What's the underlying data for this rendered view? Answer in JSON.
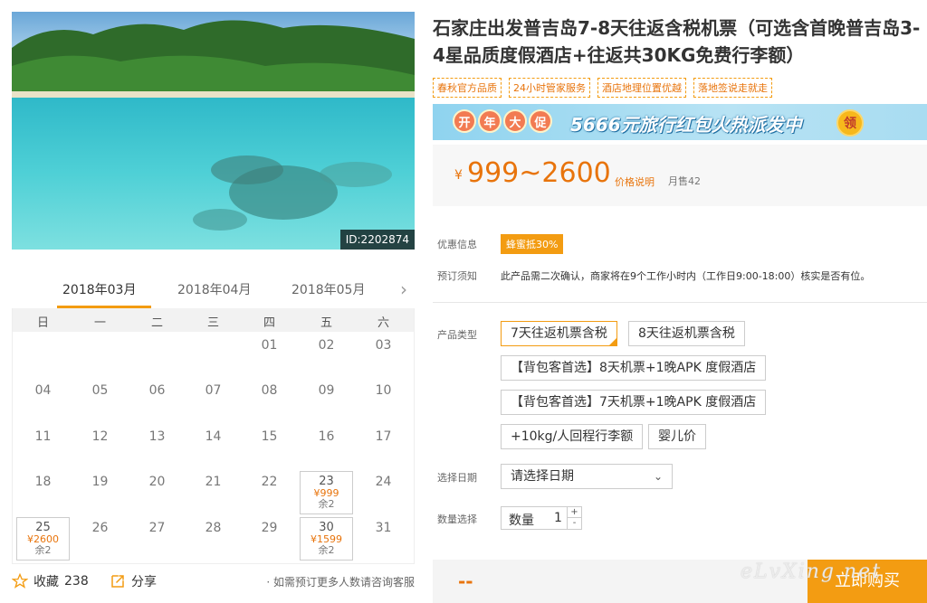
{
  "product": {
    "image_id": "ID:2202874",
    "title": "石家庄出发普吉岛7-8天往返含税机票（可选含首晚普吉岛3-4星品质度假酒店+往返共30KG免费行李额）",
    "tags": [
      "春秋官方品质",
      "24小时管家服务",
      "酒店地理位置优越",
      "落地签说走就走"
    ]
  },
  "promo": {
    "badges": [
      "开",
      "年",
      "大",
      "促"
    ],
    "text": "5666元旅行红包火热派发中",
    "coin": "领"
  },
  "price": {
    "symbol": "¥",
    "range": "999~2600",
    "note": "价格说明",
    "sold": "月售42"
  },
  "labels": {
    "offer": "优惠信息",
    "notice": "预订须知",
    "type": "产品类型",
    "date": "选择日期",
    "qty": "数量选择"
  },
  "offer_badge": "蜂蜜抵30%",
  "notice_text": "此产品需二次确认，商家将在9个工作小时内（工作日9:00-18:00）核实是否有位。",
  "options": [
    {
      "label": "7天往返机票含税",
      "selected": true
    },
    {
      "label": "8天往返机票含税",
      "selected": false
    },
    {
      "label": "【背包客首选】8天机票+1晚APK 度假酒店",
      "selected": false
    },
    {
      "label": "【背包客首选】7天机票+1晚APK 度假酒店",
      "selected": false
    },
    {
      "label": "+10kg/人回程行李额",
      "selected": false
    },
    {
      "label": "婴儿价",
      "selected": false
    }
  ],
  "date_select": {
    "placeholder": "请选择日期"
  },
  "quantity": {
    "label": "数量",
    "value": "1",
    "up": "+",
    "down": "-"
  },
  "buy": {
    "price": "--",
    "button": "立即购买"
  },
  "watermark": "eLvXing.net",
  "calendar": {
    "months": [
      "2018年03月",
      "2018年04月",
      "2018年05月"
    ],
    "active_month": 0,
    "next_arrow": "›",
    "weekdays": [
      "日",
      "一",
      "二",
      "三",
      "四",
      "五",
      "六"
    ],
    "days": [
      {
        "d": "01",
        "row": 0,
        "col": 4
      },
      {
        "d": "02",
        "row": 0,
        "col": 5
      },
      {
        "d": "03",
        "row": 0,
        "col": 6
      },
      {
        "d": "04",
        "row": 1,
        "col": 0
      },
      {
        "d": "05",
        "row": 1,
        "col": 1
      },
      {
        "d": "06",
        "row": 1,
        "col": 2
      },
      {
        "d": "07",
        "row": 1,
        "col": 3
      },
      {
        "d": "08",
        "row": 1,
        "col": 4
      },
      {
        "d": "09",
        "row": 1,
        "col": 5
      },
      {
        "d": "10",
        "row": 1,
        "col": 6
      },
      {
        "d": "11",
        "row": 2,
        "col": 0
      },
      {
        "d": "12",
        "row": 2,
        "col": 1
      },
      {
        "d": "13",
        "row": 2,
        "col": 2
      },
      {
        "d": "14",
        "row": 2,
        "col": 3
      },
      {
        "d": "15",
        "row": 2,
        "col": 4
      },
      {
        "d": "16",
        "row": 2,
        "col": 5
      },
      {
        "d": "17",
        "row": 2,
        "col": 6
      },
      {
        "d": "18",
        "row": 3,
        "col": 0
      },
      {
        "d": "19",
        "row": 3,
        "col": 1
      },
      {
        "d": "20",
        "row": 3,
        "col": 2
      },
      {
        "d": "21",
        "row": 3,
        "col": 3
      },
      {
        "d": "22",
        "row": 3,
        "col": 4
      },
      {
        "d": "23",
        "row": 3,
        "col": 5,
        "price": "¥999",
        "remain": "余2"
      },
      {
        "d": "24",
        "row": 3,
        "col": 6
      },
      {
        "d": "25",
        "row": 4,
        "col": 0,
        "price": "¥2600",
        "remain": "余2"
      },
      {
        "d": "26",
        "row": 4,
        "col": 1
      },
      {
        "d": "27",
        "row": 4,
        "col": 2
      },
      {
        "d": "28",
        "row": 4,
        "col": 3
      },
      {
        "d": "29",
        "row": 4,
        "col": 4
      },
      {
        "d": "30",
        "row": 4,
        "col": 5,
        "price": "¥1599",
        "remain": "余2"
      },
      {
        "d": "31",
        "row": 4,
        "col": 6
      }
    ]
  },
  "footer": {
    "fav_label": "收藏",
    "fav_count": "238",
    "share_label": "分享",
    "consult": "· 如需预订更多人数请咨询客服"
  }
}
